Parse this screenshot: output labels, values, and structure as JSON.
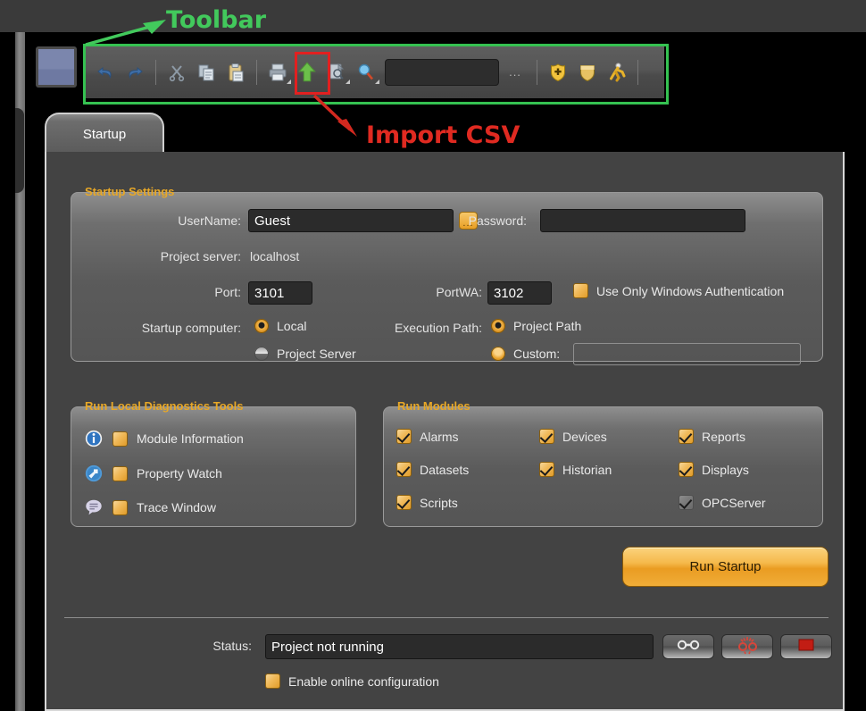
{
  "annotations": {
    "toolbar_label": "Toolbar",
    "import_label": "Import CSV",
    "green_color": "#42c95c",
    "red_color": "#e02a21"
  },
  "toolbar": {
    "items": [
      {
        "name": "undo-icon",
        "tooltip": "Undo"
      },
      {
        "name": "redo-icon",
        "tooltip": "Redo"
      },
      {
        "name": "cut-icon",
        "tooltip": "Cut"
      },
      {
        "name": "copy-icon",
        "tooltip": "Copy"
      },
      {
        "name": "paste-icon",
        "tooltip": "Paste"
      },
      {
        "name": "print-icon",
        "tooltip": "Print"
      },
      {
        "name": "import-csv-icon",
        "tooltip": "Import CSV"
      },
      {
        "name": "export-icon",
        "tooltip": "Export"
      },
      {
        "name": "search-icon",
        "tooltip": "Search"
      },
      {
        "name": "find-input",
        "value": ""
      },
      {
        "name": "overflow-ellipsis",
        "label": "..."
      },
      {
        "name": "add-shield-icon",
        "tooltip": "Add"
      },
      {
        "name": "shield-icon",
        "tooltip": "Security"
      },
      {
        "name": "run-icon",
        "tooltip": "Run"
      }
    ],
    "find_value": "",
    "ellipsis": "..."
  },
  "tab": {
    "label": "Startup"
  },
  "startup_settings": {
    "title": "Startup Settings",
    "username_label": "UserName:",
    "username_value": "Guest",
    "username_browse": "...",
    "password_label": "Password:",
    "password_value": "",
    "project_server_label": "Project server:",
    "project_server_value": "localhost",
    "port_label": "Port:",
    "port_value": "3101",
    "portwa_label": "PortWA:",
    "portwa_value": "3102",
    "windows_auth_label": "Use Only Windows Authentication",
    "windows_auth_checked": true,
    "startup_computer_label": "Startup computer:",
    "startup_computer_options": [
      "Local",
      "Project Server"
    ],
    "startup_computer_selected": "Local",
    "execution_path_label": "Execution Path:",
    "execution_path_options": [
      "Project Path",
      "Custom:"
    ],
    "execution_path_selected": "Project Path",
    "custom_path_value": ""
  },
  "diagnostics": {
    "title": "Run Local Diagnostics Tools",
    "items": [
      {
        "icon": "info-icon",
        "label": "Module Information",
        "checked": true
      },
      {
        "icon": "property-watch-icon",
        "label": "Property Watch",
        "checked": true
      },
      {
        "icon": "trace-window-icon",
        "label": "Trace Window",
        "checked": true
      }
    ]
  },
  "modules": {
    "title": "Run Modules",
    "items": [
      {
        "label": "Alarms",
        "checked": true,
        "enabled": true
      },
      {
        "label": "Devices",
        "checked": true,
        "enabled": true
      },
      {
        "label": "Reports",
        "checked": true,
        "enabled": true
      },
      {
        "label": "Datasets",
        "checked": true,
        "enabled": true
      },
      {
        "label": "Historian",
        "checked": true,
        "enabled": true
      },
      {
        "label": "Displays",
        "checked": true,
        "enabled": true
      },
      {
        "label": "Scripts",
        "checked": true,
        "enabled": true
      },
      {
        "label": "OPCServer",
        "checked": true,
        "enabled": false
      }
    ]
  },
  "run_startup": {
    "label": "Run Startup",
    "color": "#ea9c22"
  },
  "status": {
    "label": "Status:",
    "value": "Project not running",
    "buttons": [
      {
        "name": "connect-button",
        "icon": "chain-link-icon"
      },
      {
        "name": "disconnect-button",
        "icon": "broken-chain-icon"
      },
      {
        "name": "stop-button",
        "icon": "stop-square-icon"
      }
    ]
  },
  "online_config": {
    "label": "Enable online configuration",
    "checked": true
  }
}
